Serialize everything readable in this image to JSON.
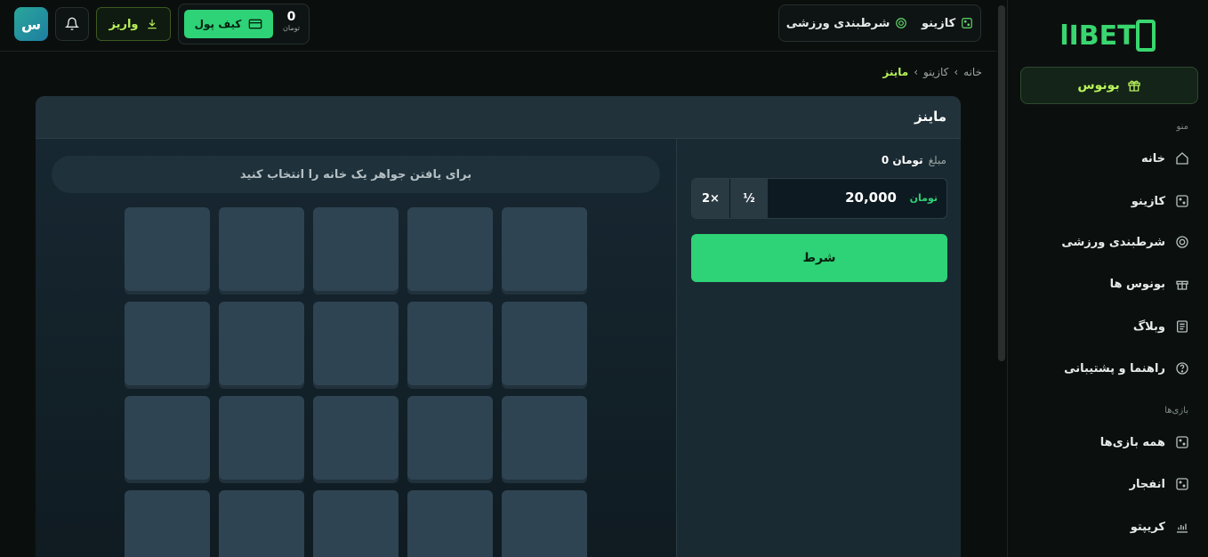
{
  "brand": {
    "logo_text": "lIBET",
    "accent": "#39d66f"
  },
  "header": {
    "avatar_letter": "س",
    "deposit_label": "واریز",
    "wallet_label": "کیف پول",
    "balance_value": "0",
    "balance_currency": "تومان",
    "top_nav": [
      {
        "label": "کازینو",
        "icon": "dice-icon"
      },
      {
        "label": "شرطبندی ورزشی",
        "icon": "target-icon"
      }
    ]
  },
  "sidebar": {
    "bonus_label": "بونوس",
    "menu_label": "منو",
    "games_label": "بازی‌ها",
    "menu": [
      {
        "label": "خانه",
        "icon": "home-icon"
      },
      {
        "label": "کازینو",
        "icon": "dice-icon"
      },
      {
        "label": "شرطبندی ورزشی",
        "icon": "target-icon"
      },
      {
        "label": "بونوس ها",
        "icon": "gift-icon"
      },
      {
        "label": "وبلاگ",
        "icon": "document-icon"
      },
      {
        "label": "راهنما و پشتیبانی",
        "icon": "help-icon"
      }
    ],
    "games": [
      {
        "label": "همه بازی‌ها",
        "icon": "dice-icon"
      },
      {
        "label": "انفجار",
        "icon": "dice-icon"
      },
      {
        "label": "کریپتو",
        "icon": "chart-icon"
      }
    ]
  },
  "breadcrumb": {
    "home": "خانه",
    "casino": "کازینو",
    "current": "ماینز",
    "sep": "›"
  },
  "game": {
    "title": "ماینز",
    "hint": "برای یافتن جواهر یک خانه را انتخاب کنید",
    "amount_label": "مبلغ",
    "amount_value": "تومان 0",
    "bet_value": "20,000",
    "bet_currency": "تومان",
    "half_label": "½",
    "double_label": "2×",
    "bet_button": "شرط"
  }
}
